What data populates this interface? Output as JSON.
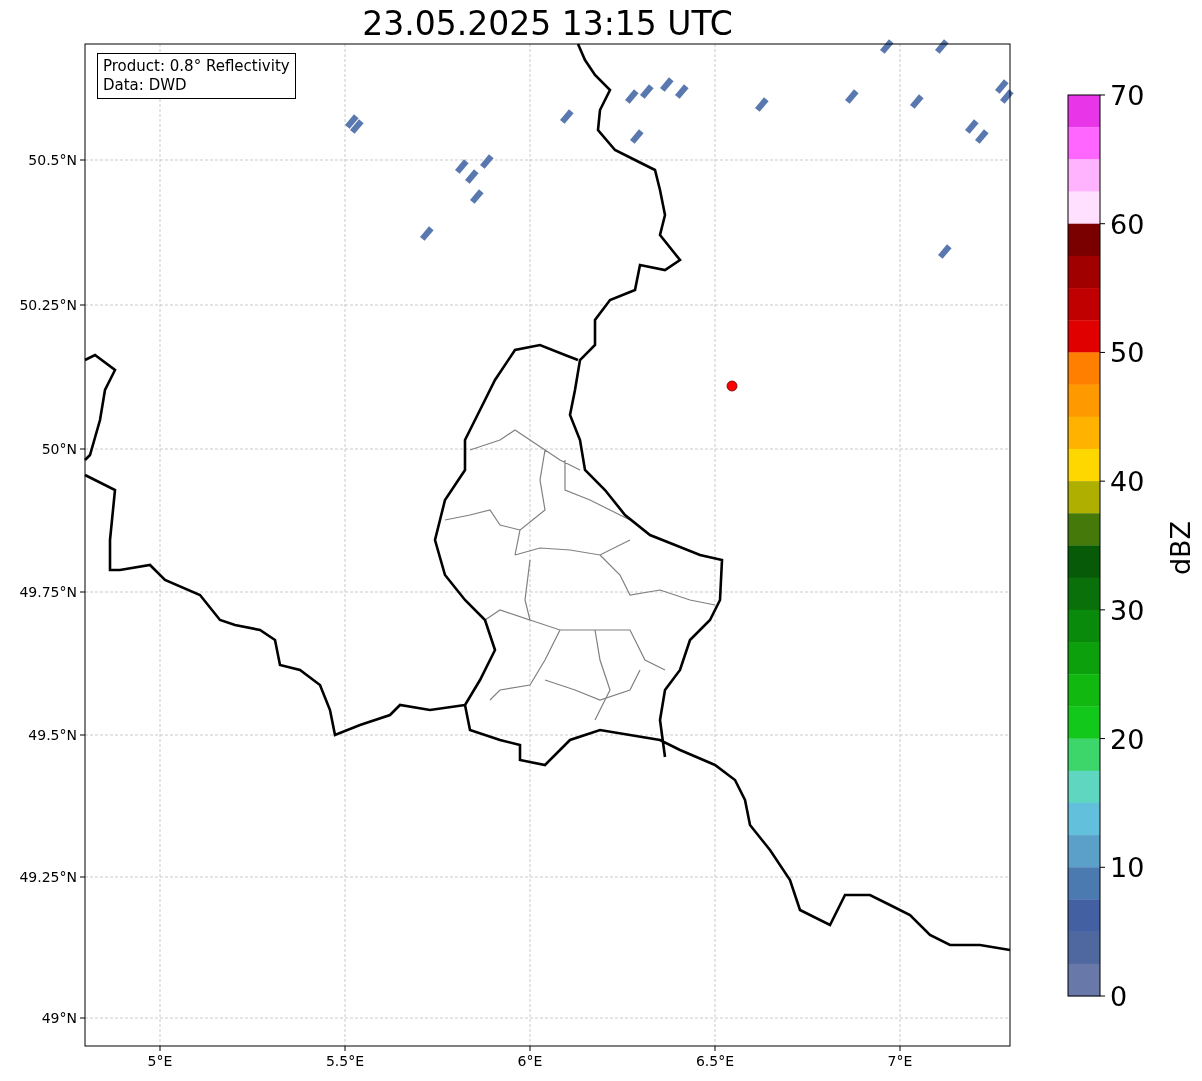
{
  "title": "23.05.2025 13:15 UTC",
  "info_box": [
    "Product: 0.8° Reflectivity",
    "Data: DWD"
  ],
  "map": {
    "x_ticks": [
      "5°E",
      "5.5°E",
      "6°E",
      "6.5°E",
      "7°E"
    ],
    "y_ticks": [
      "50.5°N",
      "50.25°N",
      "50°N",
      "49.75°N",
      "49.5°N",
      "49.25°N",
      "49°N"
    ]
  },
  "colorbar": {
    "label": "dBZ",
    "ticks": [
      "70",
      "60",
      "50",
      "40",
      "30",
      "20",
      "10",
      "0"
    ],
    "bands": [
      {
        "color": "#e835e8"
      },
      {
        "color": "#ff66ff"
      },
      {
        "color": "#ffb3ff"
      },
      {
        "color": "#ffe0ff"
      },
      {
        "color": "#7a0000"
      },
      {
        "color": "#a00000"
      },
      {
        "color": "#c00000"
      },
      {
        "color": "#e00000"
      },
      {
        "color": "#ff7f00"
      },
      {
        "color": "#ff9900"
      },
      {
        "color": "#ffb300"
      },
      {
        "color": "#ffd700"
      },
      {
        "color": "#afaf00"
      },
      {
        "color": "#457a0a"
      },
      {
        "color": "#075a07"
      },
      {
        "color": "#0a700a"
      },
      {
        "color": "#0a8a0a"
      },
      {
        "color": "#0ca00c"
      },
      {
        "color": "#10b810"
      },
      {
        "color": "#12c81a"
      },
      {
        "color": "#3dd66b"
      },
      {
        "color": "#5fd6c0"
      },
      {
        "color": "#62c0dc"
      },
      {
        "color": "#5ba0c8"
      },
      {
        "color": "#4a7ab0"
      },
      {
        "color": "#4260a2"
      },
      {
        "color": "#5068a0"
      },
      {
        "color": "#6878a8"
      }
    ]
  }
}
